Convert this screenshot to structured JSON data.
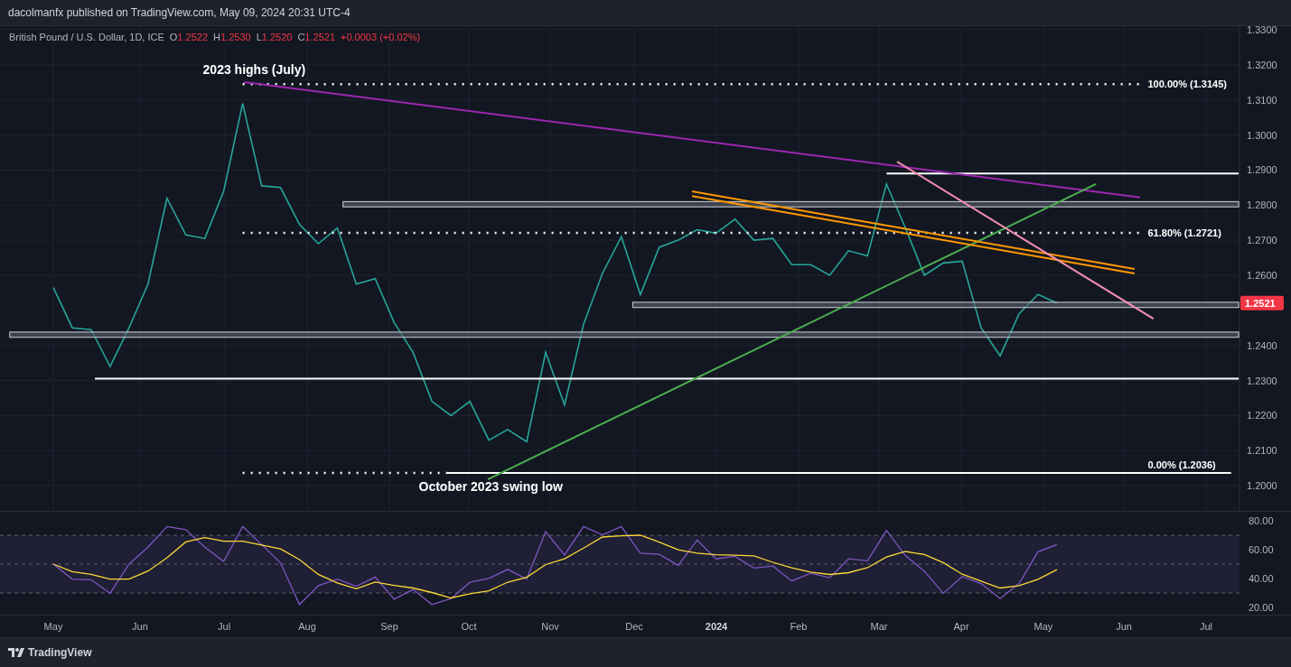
{
  "header": {
    "text": "dacolmanfx published on TradingView.com, May 09, 2024 20:31 UTC-4"
  },
  "legend": {
    "symbol": "British Pound / U.S. Dollar, 1D, ICE",
    "ohlc": [
      {
        "label": "O",
        "value": "1.2522"
      },
      {
        "label": "H",
        "value": "1.2530"
      },
      {
        "label": "L",
        "value": "1.2520"
      },
      {
        "label": "C",
        "value": "1.2521"
      }
    ],
    "change": "+0.0003 (+0.02%)"
  },
  "price_chart": {
    "last_price": "1.2521",
    "chart_data": {
      "type": "line",
      "categories": [
        null,
        null,
        null,
        null,
        null,
        null,
        null,
        null,
        null,
        null,
        null,
        null,
        null,
        null,
        null,
        null,
        null,
        null,
        null,
        null,
        null,
        null,
        null,
        null,
        null,
        null,
        null,
        null,
        null,
        null,
        null,
        null,
        null,
        null,
        null,
        null,
        null,
        null,
        null,
        null,
        null,
        null,
        null,
        null,
        null,
        null,
        null,
        null,
        null,
        null,
        null,
        null,
        null,
        null
      ],
      "values": [
        1.2565,
        1.245,
        1.2445,
        1.234,
        1.245,
        1.2575,
        1.282,
        1.2715,
        1.2705,
        1.284,
        1.309,
        1.2855,
        1.285,
        1.2745,
        1.269,
        1.2735,
        1.2575,
        1.259,
        1.2465,
        1.238,
        1.224,
        1.22,
        1.224,
        1.213,
        1.216,
        1.2125,
        1.238,
        1.223,
        1.246,
        1.2605,
        1.271,
        1.2545,
        1.268,
        1.27,
        1.273,
        1.272,
        1.276,
        1.27,
        1.2705,
        1.263,
        1.263,
        1.26,
        1.267,
        1.2655,
        1.286,
        1.2735,
        1.26,
        1.2635,
        1.264,
        1.245,
        1.237,
        1.249,
        1.2545,
        1.2521
      ],
      "ylim": [
        1.19281,
        1.33103
      ],
      "grid": true,
      "yticks": [
        {
          "value": 1.33,
          "label": "1.3300"
        },
        {
          "value": 1.32,
          "label": "1.3200"
        },
        {
          "value": 1.31,
          "label": "1.3100"
        },
        {
          "value": 1.3,
          "label": "1.3000"
        },
        {
          "value": 1.29,
          "label": "1.2900"
        },
        {
          "value": 1.28,
          "label": "1.2800"
        },
        {
          "value": 1.27,
          "label": "1.2700"
        },
        {
          "value": 1.26,
          "label": "1.2600"
        },
        {
          "value": 1.24,
          "label": "1.2400"
        },
        {
          "value": 1.23,
          "label": "1.2300"
        },
        {
          "value": 1.22,
          "label": "1.2200"
        },
        {
          "value": 1.21,
          "label": "1.2100"
        },
        {
          "value": 1.2,
          "label": "1.2000"
        }
      ]
    },
    "labels": [
      "2023 highs (July)",
      "October 2023 swing low"
    ],
    "fib_levels": [
      "100.00% (1.3145)",
      "61.80% (1.2721)",
      "0.00% (1.2036)"
    ]
  },
  "time_axis": [
    {
      "label": "May",
      "kind": "month"
    },
    {
      "label": "Jun",
      "kind": "month"
    },
    {
      "label": "Jul",
      "kind": "month"
    },
    {
      "label": "Aug",
      "kind": "month"
    },
    {
      "label": "Sep",
      "kind": "month"
    },
    {
      "label": "Oct",
      "kind": "month"
    },
    {
      "label": "Nov",
      "kind": "month"
    },
    {
      "label": "Dec",
      "kind": "month"
    },
    {
      "label": "2024",
      "kind": "year"
    },
    {
      "label": "Feb",
      "kind": "month"
    },
    {
      "label": "Mar",
      "kind": "month"
    },
    {
      "label": "Apr",
      "kind": "month"
    },
    {
      "label": "May",
      "kind": "month"
    },
    {
      "label": "Jun",
      "kind": "month"
    },
    {
      "label": "Jul",
      "kind": "month"
    }
  ],
  "rsi_panel": {
    "yticks": [
      "80.00",
      "60.00",
      "40.00",
      "20.00"
    ]
  },
  "footer": {
    "brand": "TradingView"
  }
}
